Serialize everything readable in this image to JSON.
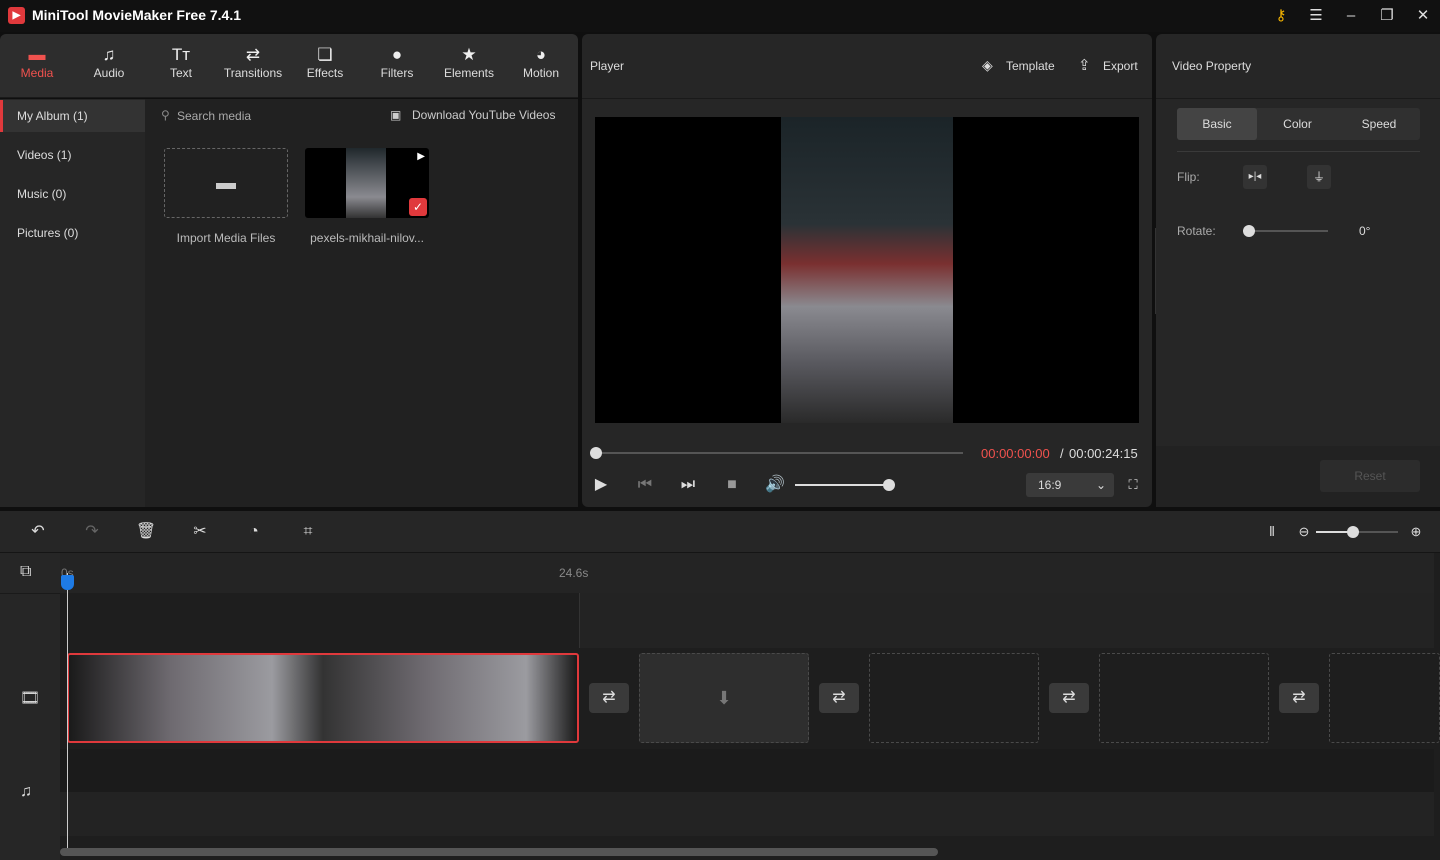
{
  "app": {
    "title": "MiniTool MovieMaker Free 7.4.1"
  },
  "nav": {
    "items": [
      {
        "label": "Media",
        "icon": "folder-icon"
      },
      {
        "label": "Audio",
        "icon": "music-note-icon"
      },
      {
        "label": "Text",
        "icon": "text-icon"
      },
      {
        "label": "Transitions",
        "icon": "transitions-icon"
      },
      {
        "label": "Effects",
        "icon": "effects-icon"
      },
      {
        "label": "Filters",
        "icon": "filters-icon"
      },
      {
        "label": "Elements",
        "icon": "elements-icon"
      },
      {
        "label": "Motion",
        "icon": "motion-icon"
      }
    ],
    "active": "Media"
  },
  "sidebar": {
    "items": [
      {
        "label": "My Album (1)"
      },
      {
        "label": "Videos (1)"
      },
      {
        "label": "Music (0)"
      },
      {
        "label": "Pictures (0)"
      }
    ]
  },
  "media": {
    "search_placeholder": "Search media",
    "download_label": "Download YouTube Videos",
    "import_label": "Import Media Files",
    "clip_name": "pexels-mikhail-nilov..."
  },
  "player": {
    "title": "Player",
    "template_label": "Template",
    "export_label": "Export",
    "current_time": "00:00:00:00",
    "separator": "/",
    "total_time": "00:00:24:15",
    "aspect": "16:9",
    "progress": 0,
    "volume": 0.9
  },
  "property": {
    "title": "Video Property",
    "tabs": [
      "Basic",
      "Color",
      "Speed"
    ],
    "active_tab": "Basic",
    "flip_label": "Flip:",
    "rotate_label": "Rotate:",
    "rotate_value": "0°",
    "reset_label": "Reset"
  },
  "timeline": {
    "start_label": "0s",
    "end_label": "24.6s",
    "zoom": 0.5
  },
  "colors": {
    "accent": "#e0393c",
    "playhead": "#1e7be6"
  }
}
